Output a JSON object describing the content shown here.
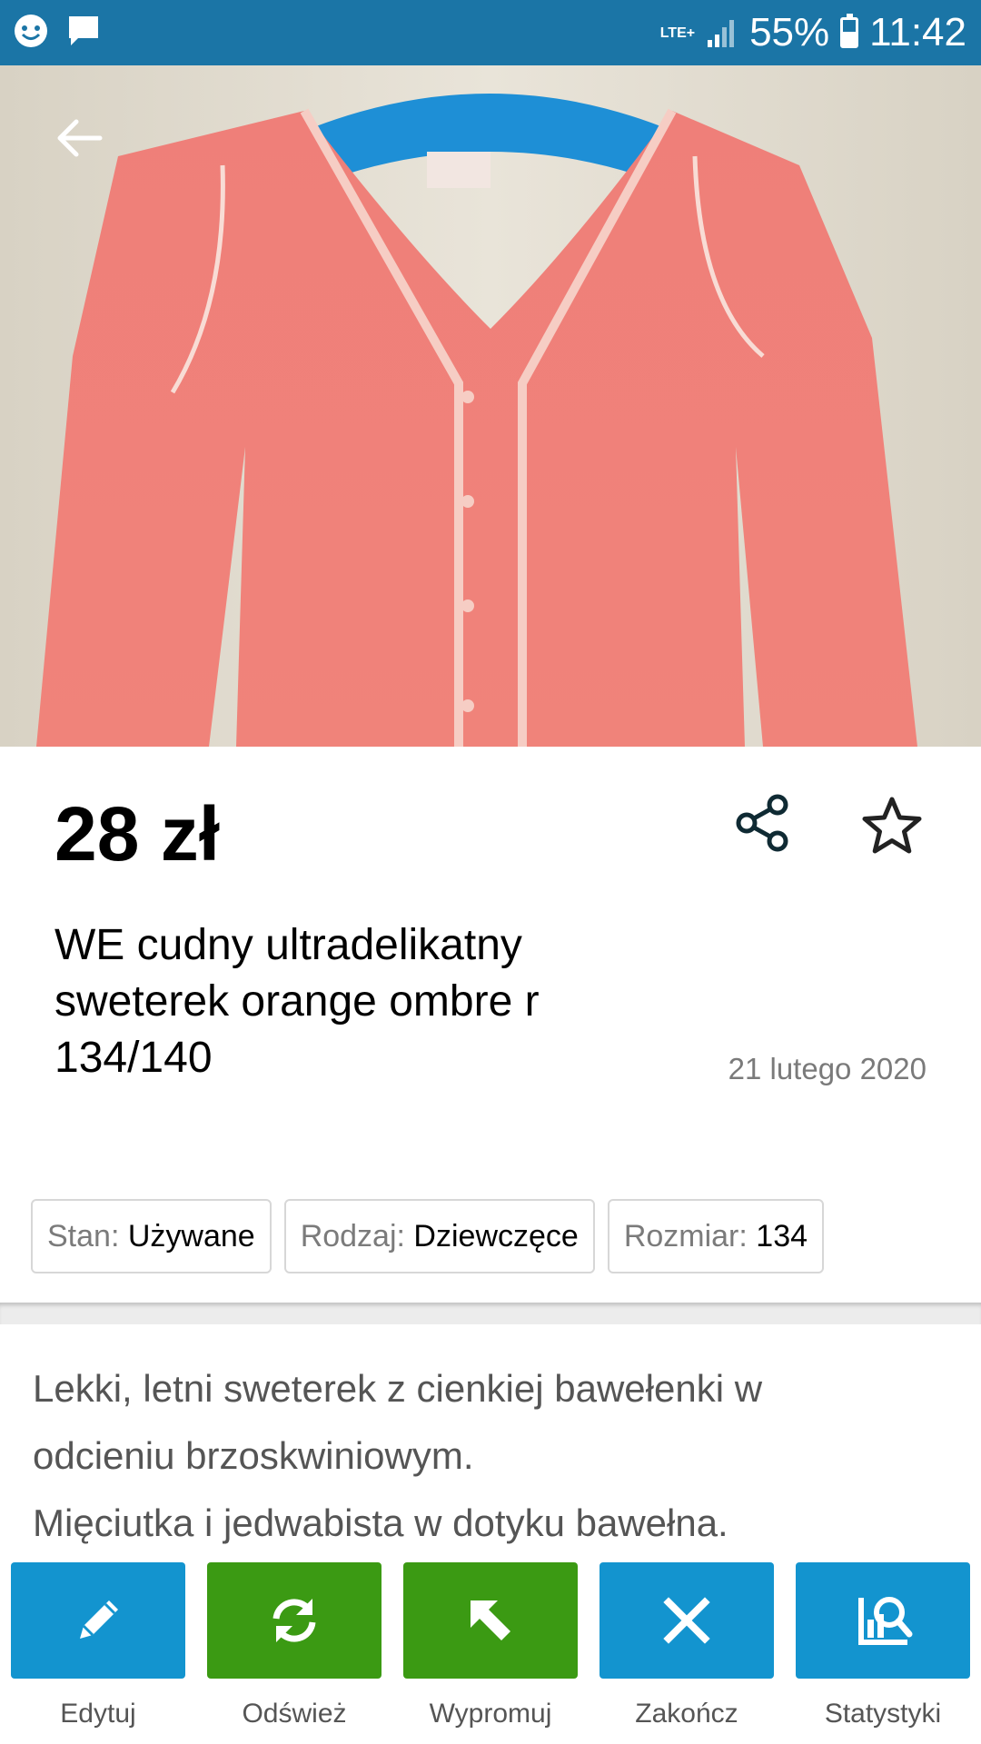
{
  "status_bar": {
    "network": "LTE+",
    "battery_percent": "55%",
    "battery_level": 0.55,
    "time": "11:42"
  },
  "gallery": {
    "image_count": 4,
    "active_index": 0
  },
  "listing": {
    "price": "28 zł",
    "title": "WE cudny ultradelikatny sweterek orange ombre r 134/140",
    "date": "21 lutego 2020"
  },
  "attributes": [
    {
      "key": "Stan:",
      "value": "Używane"
    },
    {
      "key": "Rodzaj:",
      "value": "Dziewczęce"
    },
    {
      "key": "Rozmiar:",
      "value": "134"
    }
  ],
  "description": {
    "lines": [
      "Lekki, letni sweterek z cienkiej bawełenki w",
      "odcieniu brzoskwiniowym.",
      "Mięciutka i jedwabista w dotyku bawełna."
    ]
  },
  "actions": [
    {
      "label": "Edytuj",
      "icon": "pencil-icon",
      "color": "#1394cf"
    },
    {
      "label": "Odśwież",
      "icon": "refresh-icon",
      "color": "#3b9a13"
    },
    {
      "label": "Wypromuj",
      "icon": "arrow-up-left-icon",
      "color": "#3b9a13"
    },
    {
      "label": "Zakończ",
      "icon": "close-icon",
      "color": "#1394cf"
    },
    {
      "label": "Statystyki",
      "icon": "stats-icon",
      "color": "#1394cf"
    }
  ],
  "colors": {
    "status_bar": "#1b75a6",
    "primary_blue": "#1394cf",
    "primary_green": "#3b9a13"
  }
}
